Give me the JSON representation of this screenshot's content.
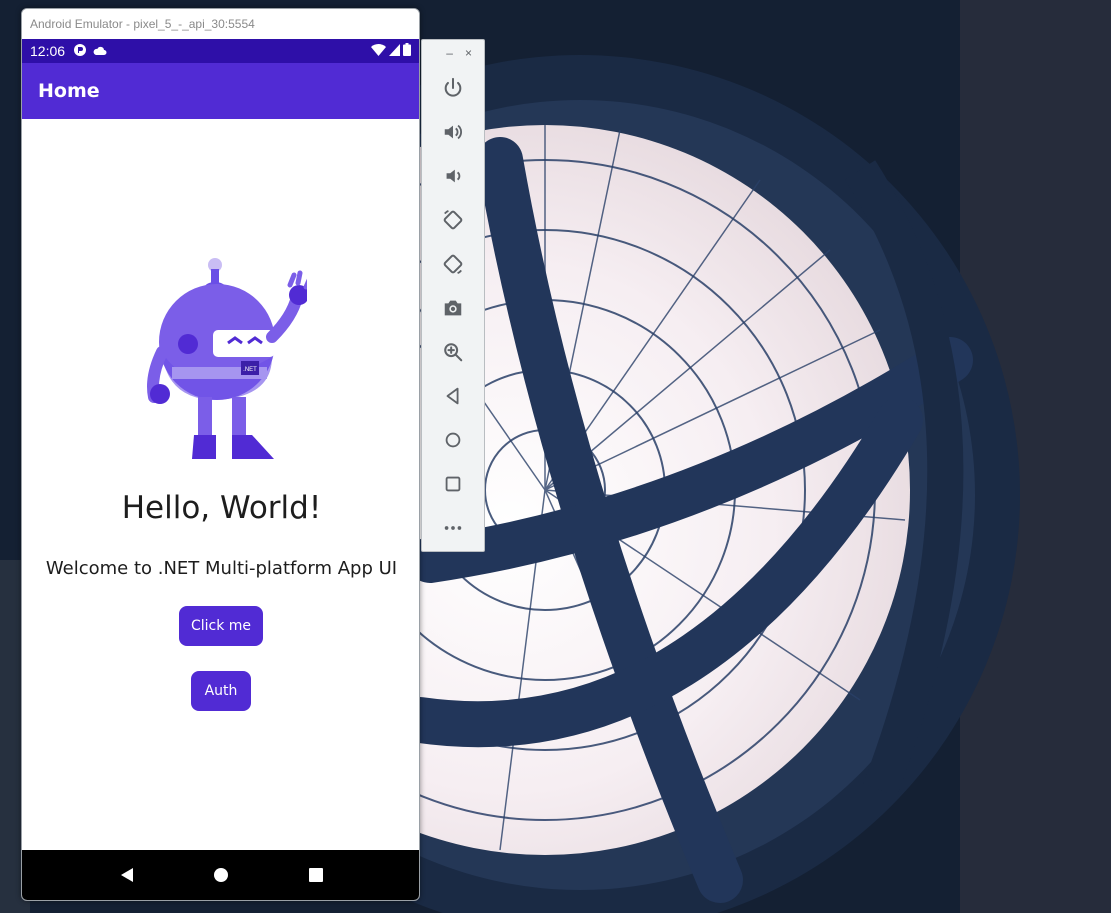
{
  "emulator": {
    "title": "Android Emulator - pixel_5_-_api_30:5554"
  },
  "status_bar": {
    "time": "12:06"
  },
  "app_bar": {
    "title": "Home"
  },
  "main": {
    "bot_badge": ".NET",
    "heading": "Hello, World!",
    "subheading": "Welcome to .NET Multi-platform App UI",
    "click_button": "Click me",
    "auth_button": "Auth"
  },
  "toolbar": {
    "minimize": "–",
    "close": "×",
    "tools": [
      "power-icon",
      "volume-up-icon",
      "volume-down-icon",
      "rotate-left-icon",
      "rotate-right-icon",
      "camera-icon",
      "zoom-icon",
      "back-icon",
      "home-icon",
      "overview-icon",
      "more-icon"
    ]
  },
  "colors": {
    "accent": "#512bd4",
    "status_bar": "#2e0fa8",
    "nav_bar": "#000000"
  }
}
